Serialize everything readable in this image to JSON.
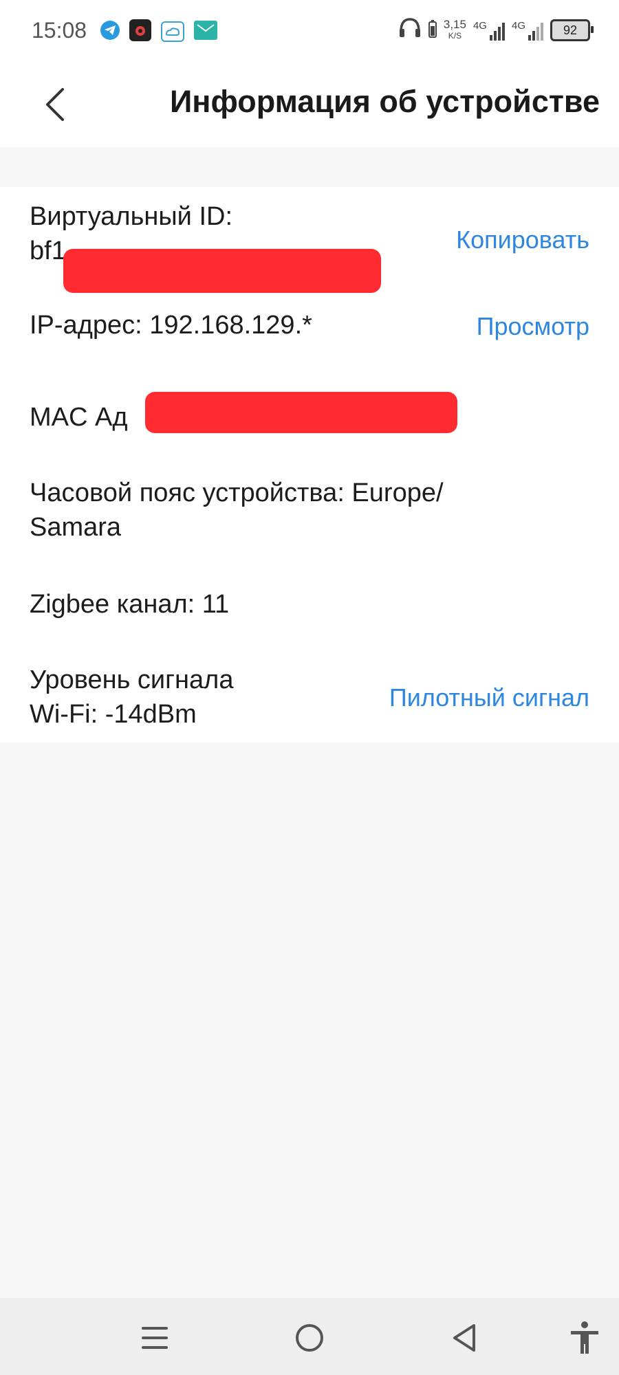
{
  "status_bar": {
    "time": "15:08",
    "net_speed_value": "3,15",
    "net_speed_unit": "K/S",
    "sim1_type": "4G",
    "sim2_type": "4G",
    "battery": "92"
  },
  "header": {
    "title": "Информация об устройстве"
  },
  "info": {
    "virtual_id_label": "Виртуальный ID:",
    "virtual_id_value": "bf1",
    "copy_action": "Копировать",
    "ip_label": "IP-адрес: 192.168.129.*",
    "ip_action": "Просмотр",
    "mac_label": "MAC Ад",
    "timezone_line1": "Часовой пояс устройства: Europe/",
    "timezone_line2": "Samara",
    "zigbee_label": "Zigbee канал: 11",
    "wifi_line1": "Уровень сигнала",
    "wifi_line2": "Wi-Fi: -14dBm",
    "wifi_action": "Пилотный сигнал"
  },
  "colors": {
    "accent": "#2e86de",
    "redaction": "#ff2b30",
    "background": "#f6f6f6"
  },
  "icons": {
    "back": "chevron-left-icon",
    "menu": "menu-icon",
    "home": "home-circle-icon",
    "nav_back": "triangle-back-icon",
    "accessibility": "accessibility-icon"
  }
}
